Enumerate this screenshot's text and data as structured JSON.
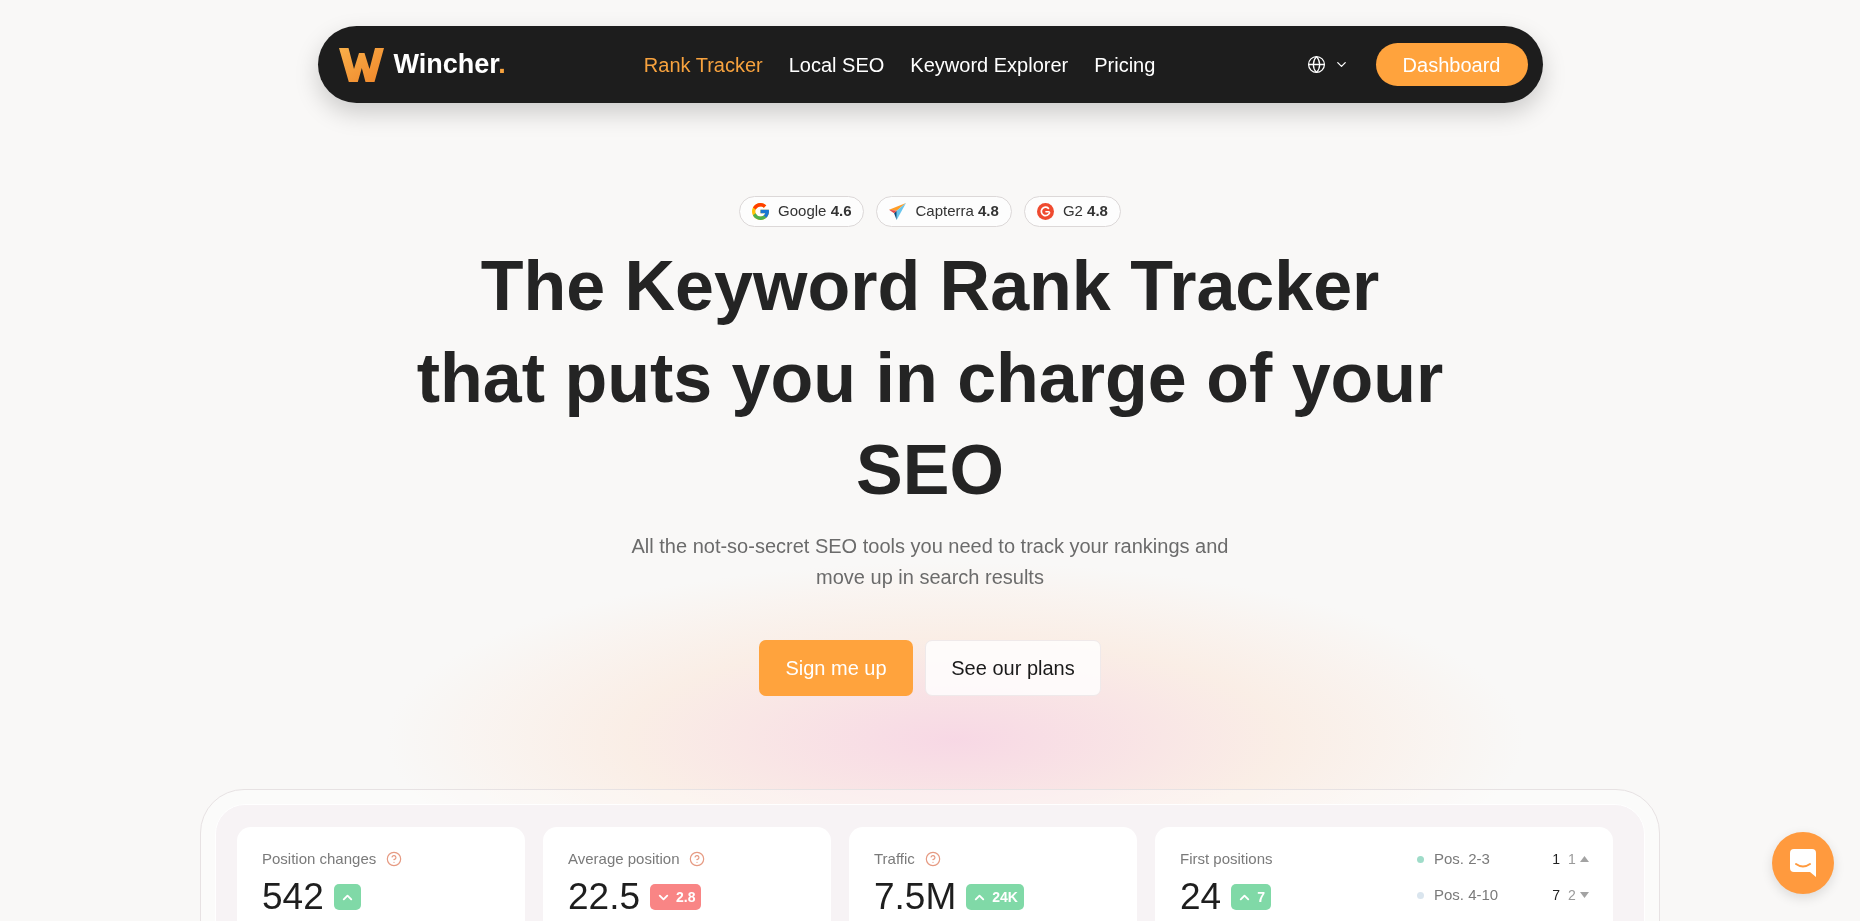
{
  "nav": {
    "logo": {
      "name": "Wincher",
      "dot": "."
    },
    "links": [
      {
        "label": "Rank Tracker",
        "selected": true
      },
      {
        "label": "Local SEO",
        "selected": false
      },
      {
        "label": "Keyword Explorer",
        "selected": false
      },
      {
        "label": "Pricing",
        "selected": false
      }
    ],
    "cta": "Dashboard"
  },
  "ratings": [
    {
      "kind": "google",
      "text": "Google **4.6**"
    },
    {
      "kind": "capterra",
      "text": "Capterra **4.8**"
    },
    {
      "kind": "g2",
      "text": "G2 **4.8**"
    }
  ],
  "hero": {
    "title": "The Keyword Rank Tracker that puts you in charge of your SEO",
    "subtitle": "All the not-so-secret SEO tools you need to track your rankings and move up in search results",
    "buttons": [
      {
        "kind": "primary",
        "label": "Sign me up"
      },
      {
        "kind": "secondary",
        "label": "See our plans"
      }
    ]
  },
  "dashboard": {
    "cards": [
      {
        "kind": "stat",
        "label": "Position changes",
        "help": true,
        "value": "542",
        "change": {
          "up": true
        }
      },
      {
        "kind": "stat",
        "label": "Average position",
        "help": true,
        "value": "22.5",
        "change": {
          "up": false,
          "text": "2.8"
        }
      },
      {
        "kind": "stat",
        "label": "Traffic",
        "help": true,
        "value": "7.5M",
        "change": {
          "up": true,
          "text": "24K"
        }
      },
      {
        "kind": "positions",
        "label": "First positions",
        "help": false,
        "value": "24",
        "change": {
          "up": true,
          "text": "7"
        },
        "legend": [
          {
            "label": "Pos. 2-3",
            "color": "#9fdcc9",
            "value": "1",
            "change": "1",
            "up": true
          },
          {
            "label": "Pos. 4-10",
            "color": "#dae5ee",
            "value": "7",
            "change": "2",
            "up": false
          }
        ]
      }
    ]
  }
}
